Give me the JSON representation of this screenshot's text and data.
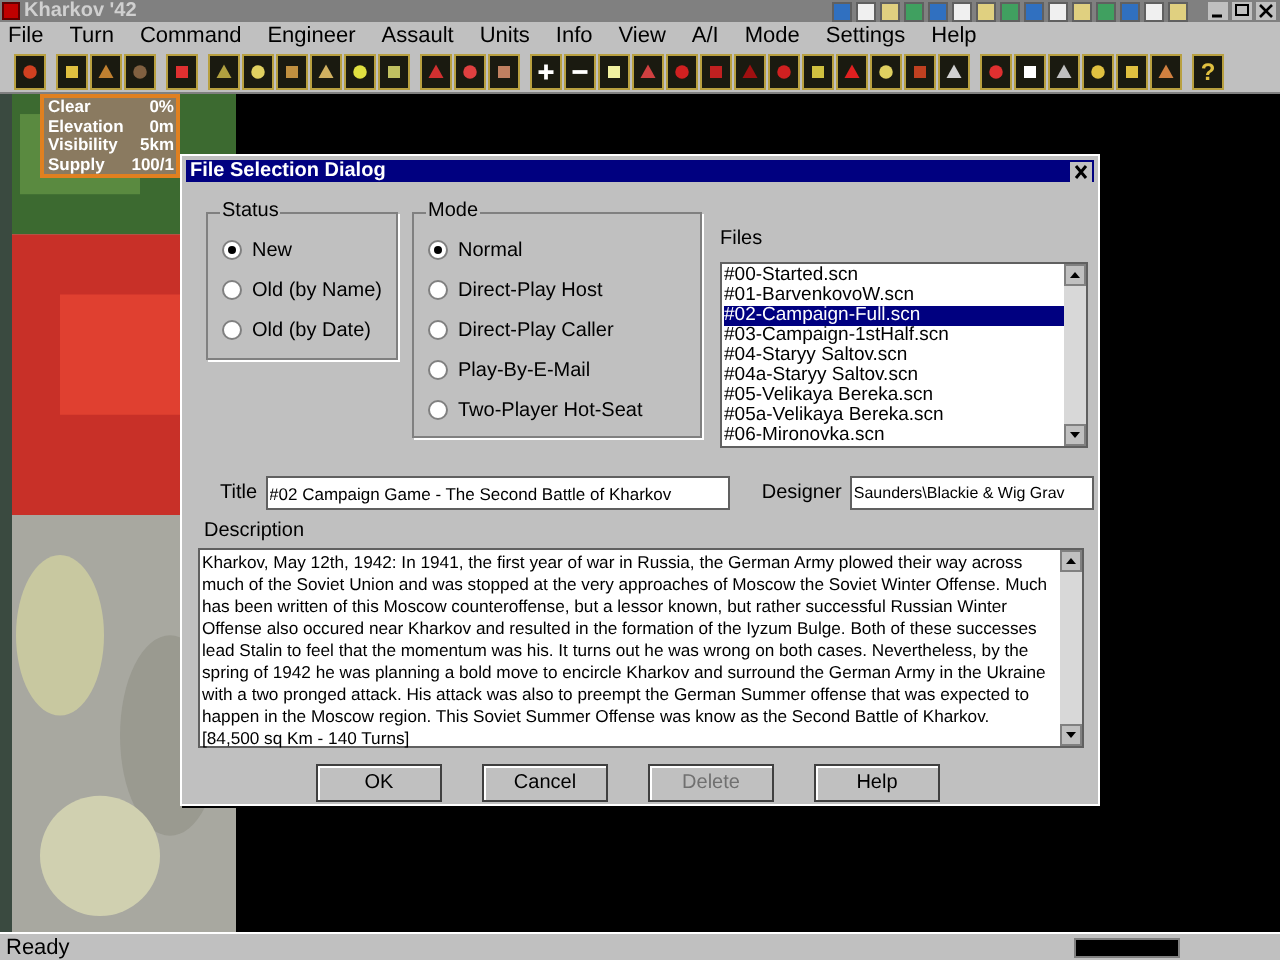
{
  "window": {
    "title": "Kharkov '42"
  },
  "menu": [
    "File",
    "Turn",
    "Command",
    "Engineer",
    "Assault",
    "Units",
    "Info",
    "View",
    "A/I",
    "Mode",
    "Settings",
    "Help"
  ],
  "toolbar_help": "?",
  "terrain_info": [
    {
      "label": "Clear",
      "value": "0%"
    },
    {
      "label": "Elevation",
      "value": "0m"
    },
    {
      "label": "Visibility",
      "value": "5km"
    },
    {
      "label": "Supply",
      "value": "100/1"
    }
  ],
  "dialog": {
    "title": "File Selection Dialog",
    "status": {
      "label": "Status",
      "options": [
        {
          "label": "New",
          "selected": true
        },
        {
          "label": "Old (by Name)",
          "selected": false
        },
        {
          "label": "Old (by Date)",
          "selected": false
        }
      ]
    },
    "mode": {
      "label": "Mode",
      "options": [
        {
          "label": "Normal",
          "selected": true
        },
        {
          "label": "Direct-Play Host",
          "selected": false
        },
        {
          "label": "Direct-Play Caller",
          "selected": false
        },
        {
          "label": "Play-By-E-Mail",
          "selected": false
        },
        {
          "label": "Two-Player Hot-Seat",
          "selected": false
        }
      ]
    },
    "files": {
      "label": "Files",
      "items": [
        {
          "name": "#00-Started.scn",
          "selected": false
        },
        {
          "name": "#01-BarvenkovoW.scn",
          "selected": false
        },
        {
          "name": "#02-Campaign-Full.scn",
          "selected": true
        },
        {
          "name": "#03-Campaign-1stHalf.scn",
          "selected": false
        },
        {
          "name": "#04-Staryy Saltov.scn",
          "selected": false
        },
        {
          "name": "#04a-Staryy Saltov.scn",
          "selected": false
        },
        {
          "name": "#05-Velikaya Bereka.scn",
          "selected": false
        },
        {
          "name": "#05a-Velikaya Bereka.scn",
          "selected": false
        },
        {
          "name": "#06-Mironovka.scn",
          "selected": false
        }
      ]
    },
    "title_label": "Title",
    "title_value": "#02 Campaign Game - The Second Battle of Kharkov",
    "designer_label": "Designer",
    "designer_value": "Saunders\\Blackie & Wig Grav",
    "description_label": "Description",
    "description": "Kharkov, May 12th, 1942: In 1941, the first year of war in Russia, the German Army plowed their way across much of the Soviet Union and was stopped at the very approaches of Moscow the Soviet Winter Offense. Much has been written of this Moscow counteroffense, but a lessor known, but rather successful Russian Winter Offense also occured near Kharkov and resulted in the formation of the Iyzum Bulge. Both of these successes lead Stalin to feel that the momentum was his. It turns out he was wrong on both cases. Nevertheless, by the spring of 1942 he was planning a bold move to encircle Kharkov and surround the German Army in the Ukraine with a two pronged attack. His attack was also to preempt the German Summer offense that was expected to happen in the Moscow region. This Soviet Summer Offense was know as the Second Battle of Kharkov. [84,500 sq Km - 140 Turns]",
    "buttons": [
      {
        "label": "OK",
        "disabled": false
      },
      {
        "label": "Cancel",
        "disabled": false
      },
      {
        "label": "Delete",
        "disabled": true
      },
      {
        "label": "Help",
        "disabled": false
      }
    ]
  },
  "status_bar": {
    "text": "Ready"
  }
}
